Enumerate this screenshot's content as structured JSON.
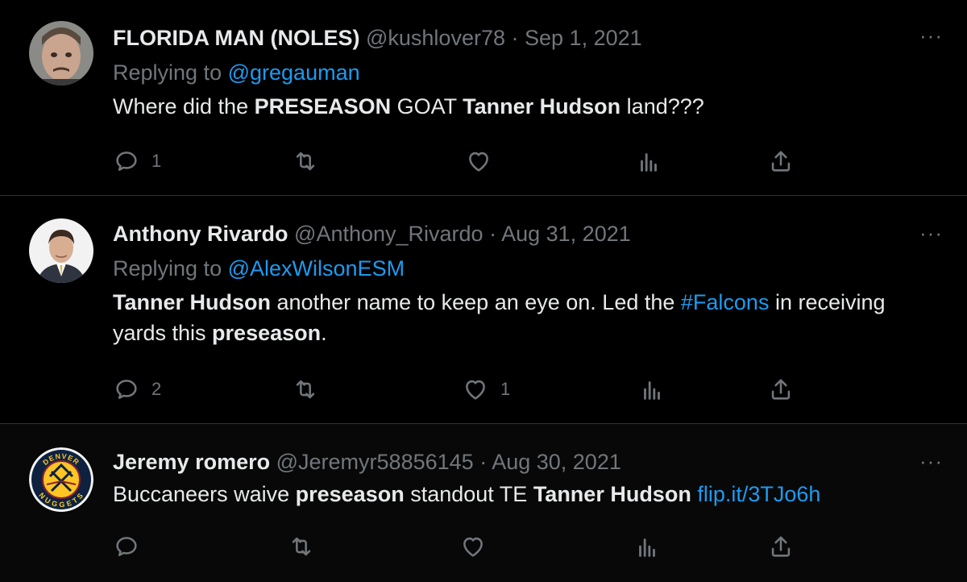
{
  "tweets": [
    {
      "name": "FLORIDA MAN (NOLES)",
      "handle": "@kushlover78",
      "separator": "·",
      "date": "Sep 1, 2021",
      "replying_prefix": "Replying to",
      "replying_to": "@gregauman",
      "text_parts": [
        "Where did the ",
        "PRESEASON",
        " GOAT ",
        "Tanner Hudson",
        " land???"
      ],
      "counts": {
        "reply": "1",
        "retweet": "",
        "like": ""
      },
      "more": "···"
    },
    {
      "name": "Anthony Rivardo",
      "handle": "@Anthony_Rivardo",
      "separator": "·",
      "date": "Aug 31, 2021",
      "replying_prefix": "Replying to",
      "replying_to": "@AlexWilsonESM",
      "text_parts": [
        "Tanner Hudson",
        " another name to keep an eye on. Led the ",
        "#Falcons",
        " in receiving yards this ",
        "preseason",
        "."
      ],
      "counts": {
        "reply": "2",
        "retweet": "",
        "like": "1"
      },
      "more": "···"
    },
    {
      "name": "Jeremy romero",
      "handle": "@Jeremyr58856145",
      "separator": "·",
      "date": "Aug 30, 2021",
      "text_parts": [
        "Buccaneers waive ",
        "preseason",
        " standout TE ",
        "Tanner Hudson",
        " ",
        "flip.it/3TJo6h"
      ],
      "counts": {
        "reply": "",
        "retweet": "",
        "like": ""
      },
      "more": "···",
      "avatar_text": {
        "top": "DENVER",
        "bottom": "NUGGETS"
      }
    }
  ],
  "colors": {
    "background": "#000000",
    "text": "#e7e9ea",
    "muted": "#71767b",
    "link": "#1d9bf0",
    "divider": "#2f3336"
  }
}
